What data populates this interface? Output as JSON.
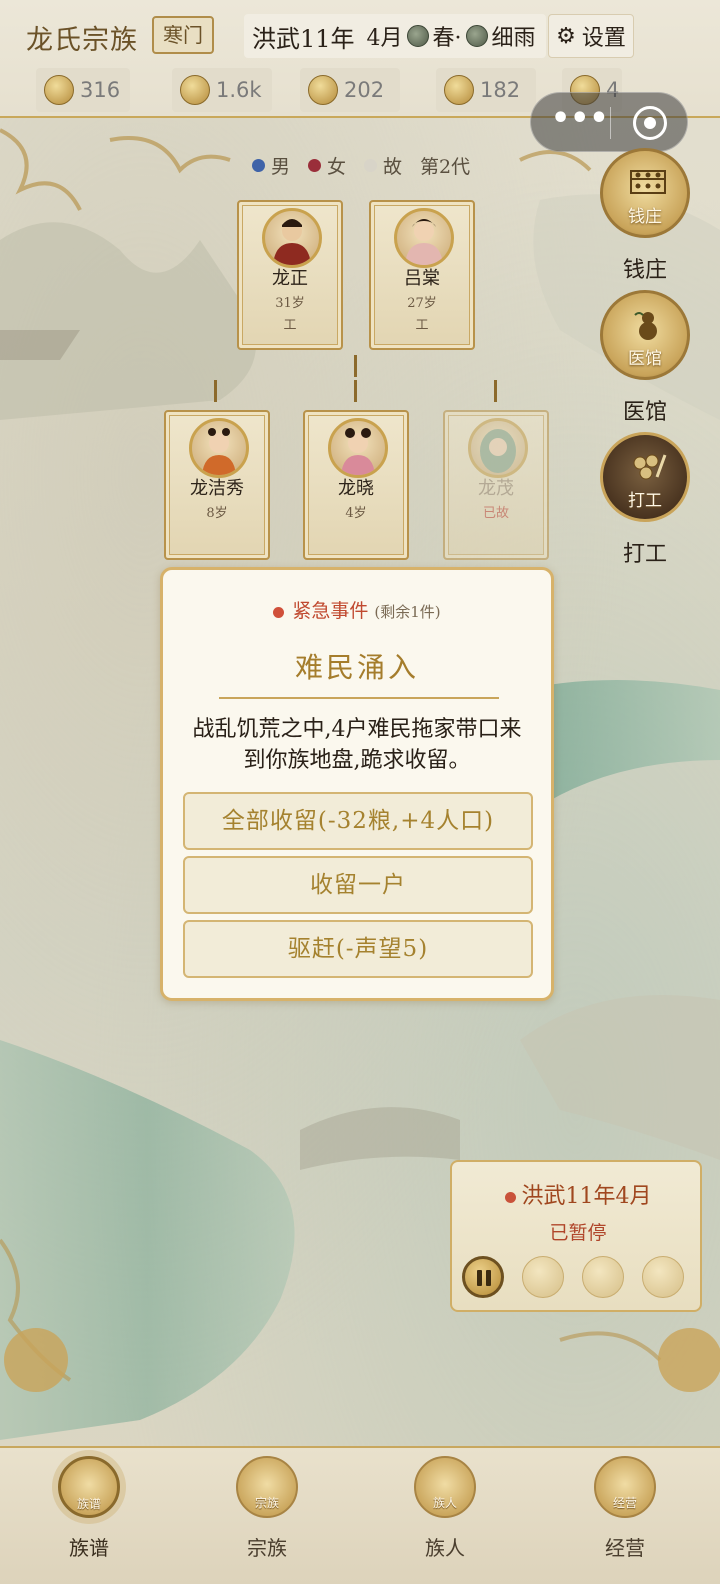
{
  "header": {
    "clan_name": "龙氏宗族",
    "clan_rank": "寒门",
    "era_year": "洪武11年",
    "month": "4月",
    "season": "春·",
    "weather": "细雨",
    "settings_label": "设置"
  },
  "resources": [
    {
      "icon": "silver-icon",
      "value": "316"
    },
    {
      "icon": "money-bag-icon",
      "value": "1.6k"
    },
    {
      "icon": "grain-icon",
      "value": "202"
    },
    {
      "icon": "prestige-icon",
      "value": "182"
    },
    {
      "icon": "population-icon",
      "value": "4"
    }
  ],
  "legend": {
    "male": "男",
    "female": "女",
    "deceased": "故",
    "generation": "第2代",
    "colors": {
      "male": "#3f63a8",
      "female": "#9a2e3a",
      "deceased": "#d8d4c8"
    }
  },
  "family": {
    "parents": [
      {
        "name": "龙正",
        "age": "31岁",
        "job": "工",
        "gender": "male"
      },
      {
        "name": "吕棠",
        "age": "27岁",
        "job": "工",
        "gender": "female"
      }
    ],
    "children": [
      {
        "name": "龙洁秀",
        "age": "8岁",
        "status": "",
        "gender": "female"
      },
      {
        "name": "龙晓",
        "age": "4岁",
        "status": "",
        "gender": "female"
      },
      {
        "name": "龙茂",
        "age": "已故",
        "status": "deceased",
        "gender": "male"
      }
    ]
  },
  "buildings": [
    {
      "caption": "钱庄",
      "label": "钱庄",
      "icon": "abacus-icon"
    },
    {
      "caption": "医馆",
      "label": "医馆",
      "icon": "gourd-icon"
    },
    {
      "caption": "打工",
      "label": "打工",
      "icon": "coins-icon"
    }
  ],
  "event": {
    "tag": "紧急事件",
    "remaining": "(剩余1件)",
    "title": "难民涌入",
    "body": "战乱饥荒之中,4户难民拖家带口来到你族地盘,跪求收留。",
    "options": [
      "全部收留(-32粮,+4人口)",
      "收留一户",
      "驱赶(-声望5)"
    ]
  },
  "time_panel": {
    "date": "洪武11年4月",
    "status": "已暂停"
  },
  "bottom_nav": [
    {
      "icon_caption": "族谱",
      "label": "族谱",
      "icon": "book-icon"
    },
    {
      "icon_caption": "宗族",
      "label": "宗族",
      "icon": "hall-icon"
    },
    {
      "icon_caption": "族人",
      "label": "族人",
      "icon": "people-icon"
    },
    {
      "icon_caption": "经营",
      "label": "经营",
      "icon": "abacus-icon"
    }
  ]
}
